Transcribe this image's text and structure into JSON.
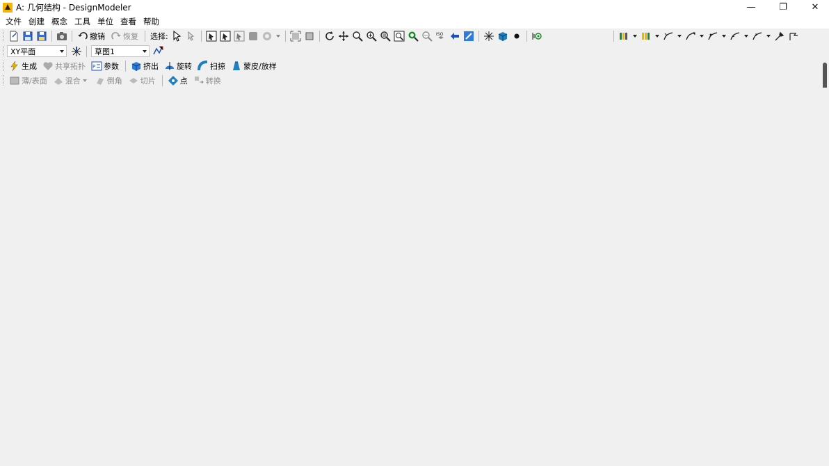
{
  "window": {
    "title": "A: 几何结构 - DesignModeler",
    "minimize": "—",
    "maximize": "❐",
    "close": "✕"
  },
  "menu": [
    "文件",
    "创建",
    "概念",
    "工具",
    "单位",
    "查看",
    "帮助"
  ],
  "toolbar_main": {
    "undo_label": "撤销",
    "redo_label": "恢复",
    "select_label": "选择:"
  },
  "plane_row": {
    "plane_value": "XY平面",
    "sketch_value": "草图1"
  },
  "feature_row": {
    "generate": "生成",
    "share_topology": "共享拓扑",
    "parameters": "参数",
    "extrude": "挤出",
    "revolve": "旋转",
    "sweep": "扫掠",
    "skin_loft": "蒙皮/放样"
  },
  "feature_row2": {
    "thin_surface": "薄/表面",
    "blend": "混合",
    "chamfer": "倒角",
    "slice": "切片",
    "point": "点",
    "convert": "转换"
  },
  "colors": {
    "accent_blue": "#1f4fb4",
    "icon_green": "#1a8a2a",
    "icon_yellow": "#e8b800",
    "icon_red": "#c0282a"
  }
}
